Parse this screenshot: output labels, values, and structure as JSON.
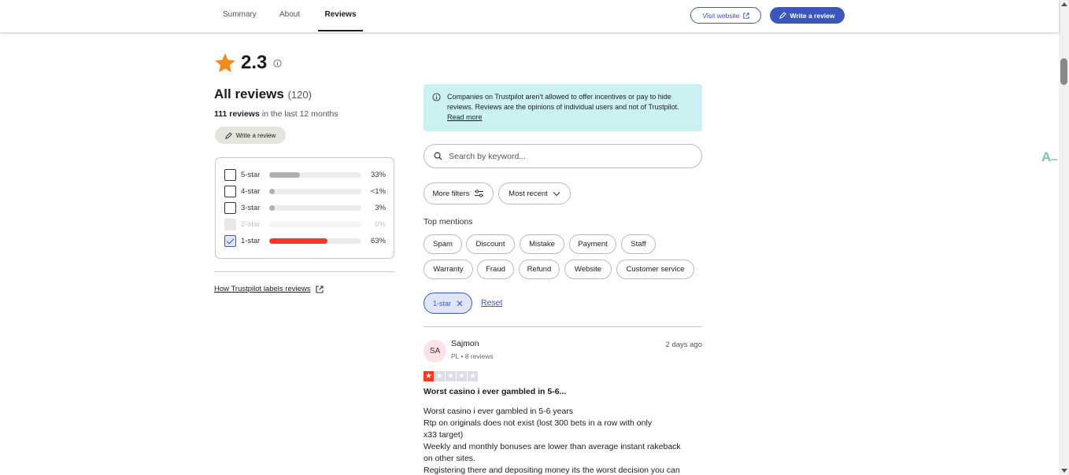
{
  "nav": {
    "tabs": [
      {
        "label": "Summary",
        "active": false
      },
      {
        "label": "About",
        "active": false
      },
      {
        "label": "Reviews",
        "active": true
      }
    ],
    "visit_website": "Visit website",
    "write_review": "Write a review"
  },
  "summary": {
    "rating": "2.3",
    "all_reviews_label": "All reviews",
    "all_reviews_count": "(120)",
    "last12_count": "111 reviews",
    "last12_suffix": " in the last 12 months",
    "write_review_small": "Write a review",
    "distribution": [
      {
        "label": "5-star",
        "percent": "33%",
        "fill": 0.33,
        "color": "#b0b0b0",
        "checked": false,
        "disabled": false
      },
      {
        "label": "4-star",
        "percent": "<1%",
        "fill": 0.05,
        "color": "#b0b0b0",
        "checked": false,
        "disabled": false
      },
      {
        "label": "3-star",
        "percent": "3%",
        "fill": 0.06,
        "color": "#b0b0b0",
        "checked": false,
        "disabled": false
      },
      {
        "label": "2-star",
        "percent": "0%",
        "fill": 0.0,
        "color": "#b0b0b0",
        "checked": false,
        "disabled": true
      },
      {
        "label": "1-star",
        "percent": "63%",
        "fill": 0.63,
        "color": "#ef3a2a",
        "checked": true,
        "disabled": false
      }
    ],
    "labels_link": "How Trustpilot labels reviews"
  },
  "notice": {
    "text": "Companies on Trustpilot aren't allowed to offer incentives or pay to hide reviews. Reviews are the opinions of individual users and not of Trustpilot.",
    "read_more": "Read more"
  },
  "search": {
    "placeholder": "Search by keyword..."
  },
  "filters": {
    "more_filters": "More filters",
    "sort": "Most recent"
  },
  "top_mentions": {
    "title": "Top mentions",
    "tags": [
      "Spam",
      "Discount",
      "Mistake",
      "Payment",
      "Staff",
      "Warranty",
      "Fraud",
      "Refund",
      "Website",
      "Customer service"
    ]
  },
  "active_filters": {
    "chip": "1-star",
    "reset": "Reset"
  },
  "review": {
    "initials": "SA",
    "name": "Sajmon",
    "meta": "PL • 8 reviews",
    "date": "2 days ago",
    "rating": 1,
    "title": "Worst casino i ever gambled in 5-6...",
    "body_lines": [
      "Worst casino i ever gambled in 5-6 years",
      "Rtp on originals does not exist (lost 300 bets in a row with only",
      "x33 target)",
      "Weekly and monthly bonuses are lower than average instant rakeback",
      "on other sites.",
      "Registering there and depositing money its the worst decision you can"
    ]
  },
  "colors": {
    "accent": "#3c57bc",
    "star_orange": "#f28b1d",
    "one_star_red": "#ff3722",
    "notice_bg": "#ccf1f3"
  }
}
